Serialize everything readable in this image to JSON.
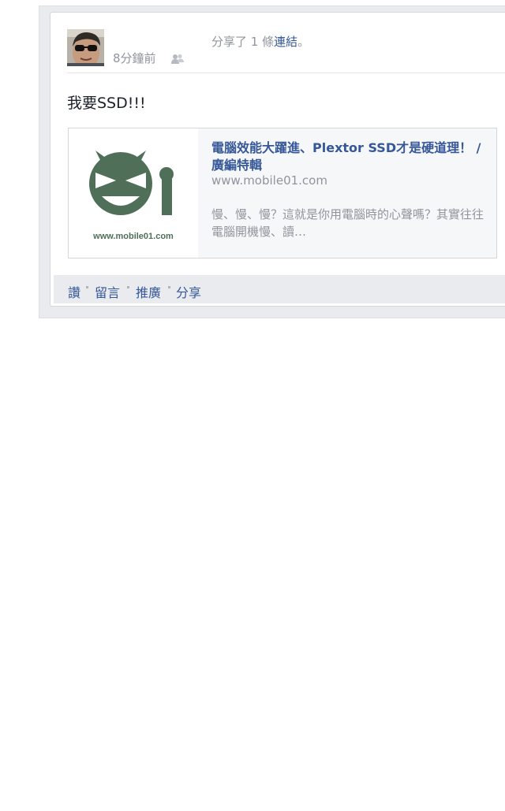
{
  "post": {
    "timestamp": "8分鐘前",
    "audience_icon": "friends-icon",
    "share_prefix": "分享了 1 條",
    "share_link": "連結",
    "share_suffix": "。",
    "text": "我要SSD!!!"
  },
  "link_preview": {
    "title": "電腦效能大躍進、Plextor SSD才是硬道理！ / 廣編特輯",
    "domain": "www.mobile01.com",
    "description": "慢、慢、慢？這就是你用電腦時的心聲嗎？其實往往電腦開機慢、讀…",
    "image_caption": "www.mobile01.com",
    "logo_color": "#4f6f58"
  },
  "actions": [
    {
      "label": "讚"
    },
    {
      "label": "留言"
    },
    {
      "label": "推廣"
    },
    {
      "label": "分享"
    }
  ],
  "colors": {
    "link": "#365899",
    "muted": "#90949c",
    "frame": "#e9ebee"
  }
}
